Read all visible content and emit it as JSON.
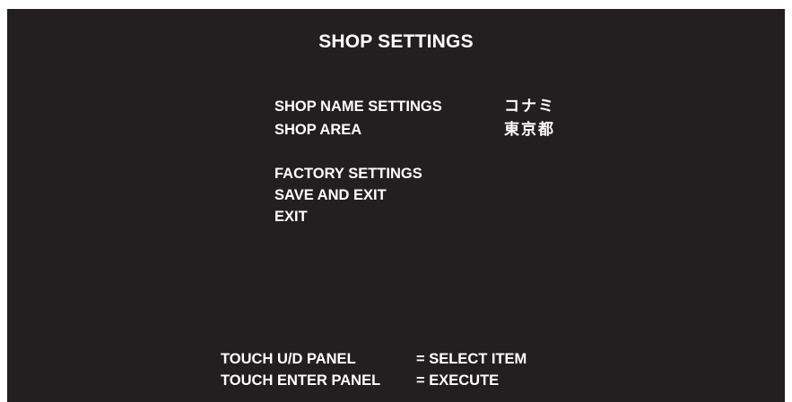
{
  "screen": {
    "title": "SHOP SETTINGS"
  },
  "menu": {
    "items": [
      {
        "label": "SHOP NAME SETTINGS",
        "value": "コナミ"
      },
      {
        "label": "SHOP AREA",
        "value": "東京都"
      },
      {
        "label": "FACTORY SETTINGS"
      },
      {
        "label": "SAVE AND EXIT"
      },
      {
        "label": "EXIT"
      }
    ]
  },
  "instructions": [
    {
      "key": "TOUCH U/D PANEL",
      "action": "= SELECT ITEM"
    },
    {
      "key": "TOUCH ENTER PANEL",
      "action": "= EXECUTE"
    }
  ],
  "colors": {
    "background": "#231f20",
    "text": "#ffffff"
  }
}
